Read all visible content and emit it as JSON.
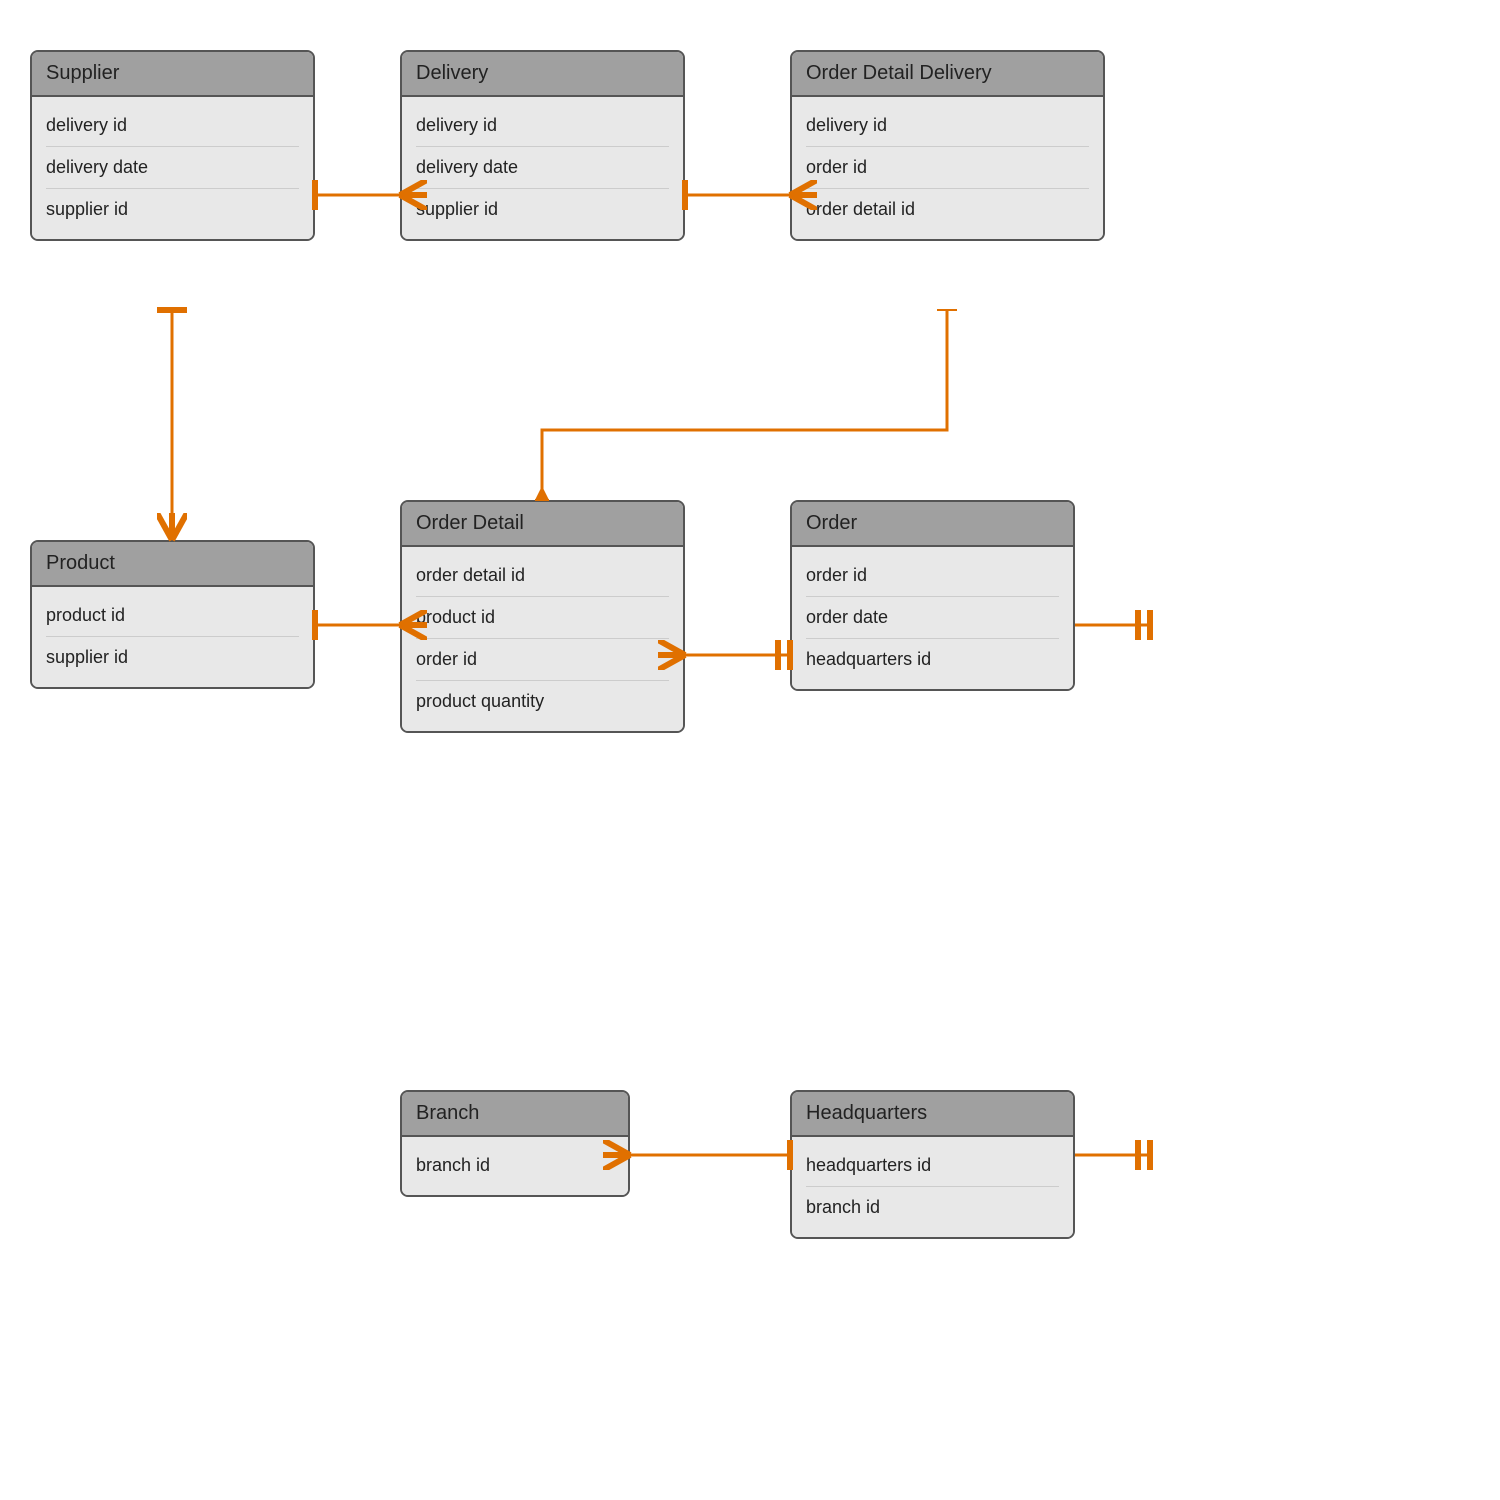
{
  "tables": {
    "supplier": {
      "title": "Supplier",
      "fields": [
        "delivery id",
        "delivery date",
        "supplier id"
      ],
      "style": "top:50px; left:30px; width:280px;"
    },
    "delivery": {
      "title": "Delivery",
      "fields": [
        "delivery id",
        "delivery date",
        "supplier id"
      ],
      "style": "top:50px; left:400px; width:280px;"
    },
    "order_detail_delivery": {
      "title": "Order Detail Delivery",
      "fields": [
        "delivery id",
        "order id",
        "order detail id"
      ],
      "style": "top:50px; left:790px; width:310px;"
    },
    "product": {
      "title": "Product",
      "fields": [
        "product id",
        "supplier id"
      ],
      "style": "top:540px; left:30px; width:280px;"
    },
    "order_detail": {
      "title": "Order Detail",
      "fields": [
        "order detail id",
        "product id",
        "order id",
        "product quantity"
      ],
      "style": "top:500px; left:400px; width:280px;"
    },
    "order": {
      "title": "Order",
      "fields": [
        "order id",
        "order date",
        "headquarters id"
      ],
      "style": "top:500px; left:790px; width:280px;"
    },
    "branch": {
      "title": "Branch",
      "fields": [
        "branch id"
      ],
      "style": "top:1090px; left:400px; width:220px;"
    },
    "headquarters": {
      "title": "Headquarters",
      "fields": [
        "headquarters id",
        "branch id"
      ],
      "style": "top:1090px; left:790px; width:280px;"
    }
  }
}
